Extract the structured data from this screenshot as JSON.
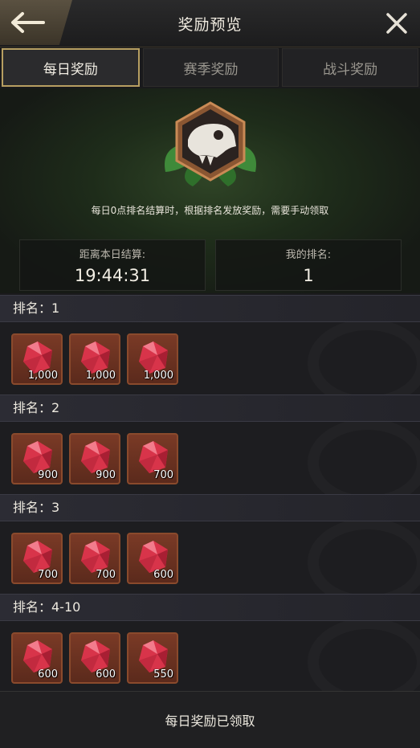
{
  "header": {
    "title": "奖励预览",
    "back_icon": "arrow-left-icon",
    "close_icon": "close-icon"
  },
  "tabs": [
    {
      "label": "每日奖励",
      "active": true
    },
    {
      "label": "赛季奖励",
      "active": false
    },
    {
      "label": "战斗奖励",
      "active": false
    }
  ],
  "hero": {
    "emblem_icon": "dinosaur-skull-emblem-icon",
    "description": "每日0点排名结算时，根据排名发放奖励，需要手动领取",
    "countdown": {
      "label": "距离本日结算:",
      "value": "19:44:31"
    },
    "my_rank": {
      "label": "我的排名:",
      "value": "1"
    }
  },
  "ranks": [
    {
      "label": "排名：1",
      "rewards": [
        {
          "icon": "red-gem-icon",
          "qty": "1,000"
        },
        {
          "icon": "red-gem-icon",
          "qty": "1,000"
        },
        {
          "icon": "red-gem-icon",
          "qty": "1,000"
        }
      ]
    },
    {
      "label": "排名：2",
      "rewards": [
        {
          "icon": "red-gem-icon",
          "qty": "900"
        },
        {
          "icon": "red-gem-icon",
          "qty": "900"
        },
        {
          "icon": "red-gem-icon",
          "qty": "700"
        }
      ]
    },
    {
      "label": "排名：3",
      "rewards": [
        {
          "icon": "red-gem-icon",
          "qty": "700"
        },
        {
          "icon": "red-gem-icon",
          "qty": "700"
        },
        {
          "icon": "red-gem-icon",
          "qty": "600"
        }
      ]
    },
    {
      "label": "排名：4-10",
      "rewards": [
        {
          "icon": "red-gem-icon",
          "qty": "600"
        },
        {
          "icon": "red-gem-icon",
          "qty": "600"
        },
        {
          "icon": "red-gem-icon",
          "qty": "550"
        }
      ]
    }
  ],
  "footer": {
    "status": "每日奖励已领取"
  },
  "colors": {
    "accent_gold": "#b79f61",
    "item_border": "#8a4a2c",
    "gem": "#d8344a"
  }
}
